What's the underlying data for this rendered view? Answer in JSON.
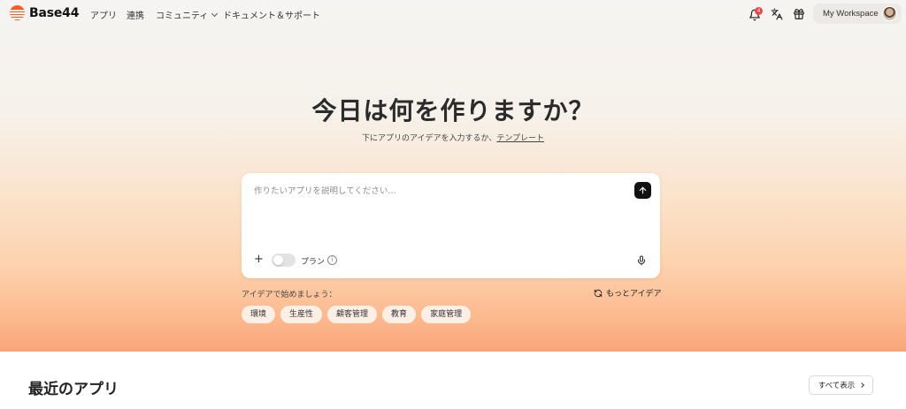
{
  "nav": {
    "brand": "Base44",
    "links": [
      "アプリ",
      "連携",
      "コミュニティ",
      "ドキュメント＆サポート"
    ],
    "notification_count": "4",
    "workspace_label": "My Workspace"
  },
  "hero": {
    "title": "今日は何を作りますか？",
    "subtitle_prefix": "下にアプリのアイデアを入力するか、",
    "subtitle_link": "テンプレート"
  },
  "prompt": {
    "placeholder": "作りたいアプリを説明してください...",
    "plan_label": "プラン",
    "plan_enabled": false
  },
  "ideas": {
    "label": "アイデアで始めましょう：",
    "more_label": "もっとアイデア",
    "chips": [
      "環境",
      "生産性",
      "顧客管理",
      "教育",
      "家庭管理"
    ]
  },
  "recent": {
    "title": "最近のアプリ",
    "show_all_label": "すべて表示"
  },
  "colors": {
    "brand": "#ff5a1f",
    "send_button": "#111111",
    "badge": "#ef4444"
  }
}
